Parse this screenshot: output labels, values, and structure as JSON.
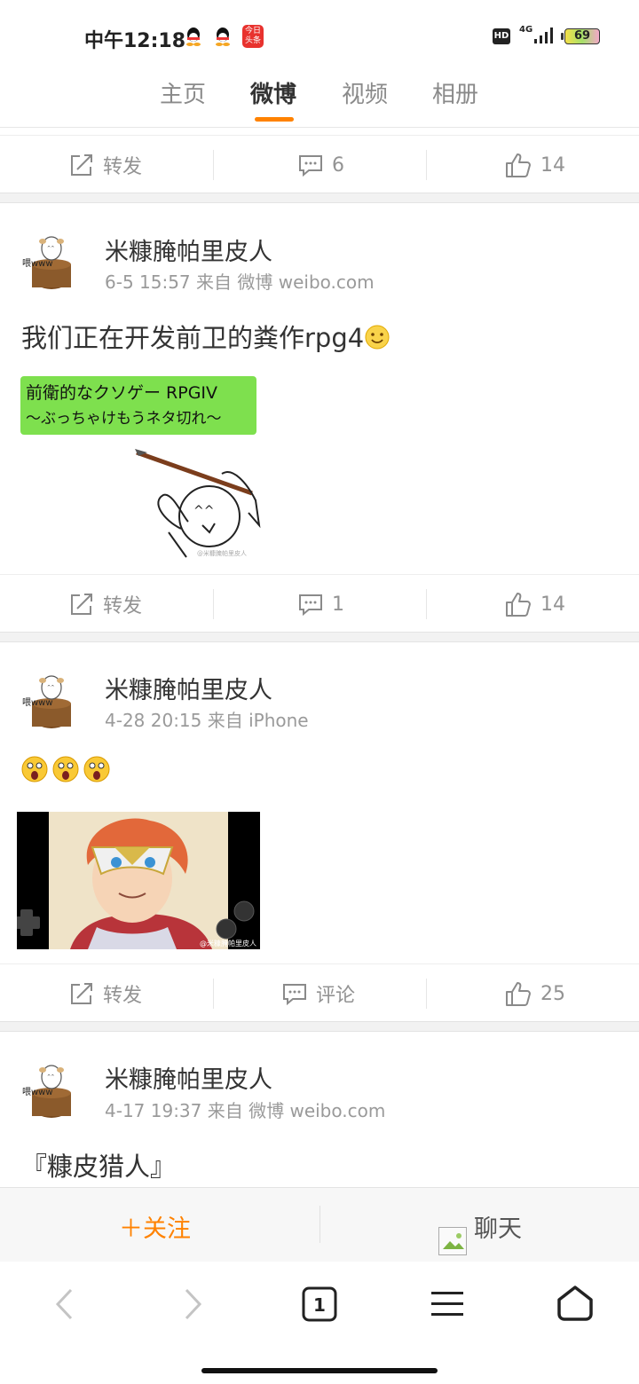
{
  "status_bar": {
    "time": "中午12:18",
    "network": "4G",
    "hd": "HD",
    "battery": "69",
    "news_icon_text": "今日\n头条"
  },
  "tabs": [
    {
      "label": "主页",
      "active": false
    },
    {
      "label": "微博",
      "active": true
    },
    {
      "label": "视频",
      "active": false
    },
    {
      "label": "相册",
      "active": false
    }
  ],
  "accent_color": "#ff8200",
  "top_actions": {
    "repost": "转发",
    "comments": "6",
    "likes": "14"
  },
  "posts": [
    {
      "author": "米糠腌帕里皮人",
      "meta": "6-5 15:57 来自 微博 weibo.com",
      "text": "我们正在开发前卫的粪作rpg4",
      "image_title": "前衛的なクソゲー RPGIV",
      "image_subtitle": "〜ぶっちゃけもうネタ切れ〜",
      "watermark": "@米糠腌帕里皮人",
      "actions": {
        "repost": "转发",
        "comments": "1",
        "likes": "14"
      }
    },
    {
      "author": "米糠腌帕里皮人",
      "meta": "4-28 20:15 来自 iPhone",
      "text": "",
      "watermark": "@米糠腌帕里皮人",
      "actions": {
        "repost": "转发",
        "comments": "评论",
        "likes": "25"
      }
    },
    {
      "author": "米糠腌帕里皮人",
      "meta": "4-17 19:37 来自 微博 weibo.com",
      "text": "『糠皮猎人』"
    }
  ],
  "avatar_text": "喂www",
  "bottom_bar": {
    "follow": "关注",
    "chat": "聊天"
  },
  "nav": {
    "tab_count": "1"
  }
}
